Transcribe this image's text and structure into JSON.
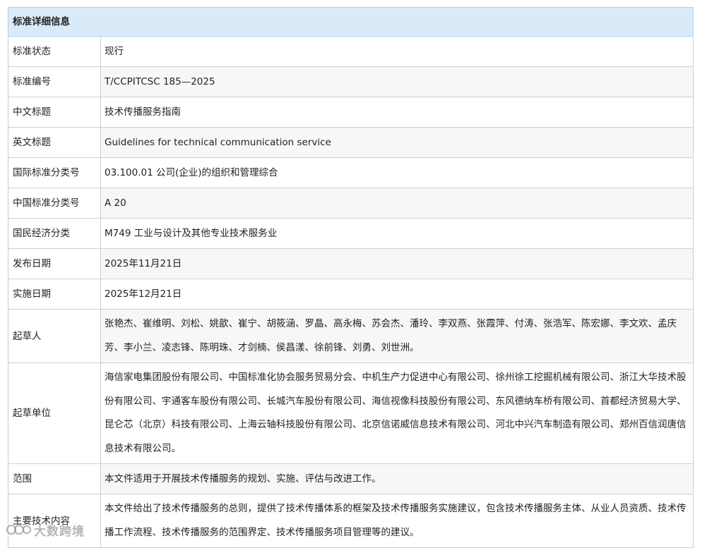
{
  "table": {
    "title": "标准详细信息",
    "rows": [
      {
        "label": "标准状态",
        "value": "现行"
      },
      {
        "label": "标准编号",
        "value": "T/CCPITCSC 185—2025"
      },
      {
        "label": "中文标题",
        "value": "技术传播服务指南"
      },
      {
        "label": "英文标题",
        "value": "Guidelines for technical communication service"
      },
      {
        "label": "国际标准分类号",
        "value": "03.100.01 公司(企业)的组织和管理综合"
      },
      {
        "label": "中国标准分类号",
        "value": "A 20"
      },
      {
        "label": "国民经济分类",
        "value": "M749 工业与设计及其他专业技术服务业"
      },
      {
        "label": "发布日期",
        "value": "2025年11月21日"
      },
      {
        "label": "实施日期",
        "value": "2025年12月21日"
      },
      {
        "label": "起草人",
        "value": "张艳杰、崔维明、刘松、姚歆、崔宁、胡筱涵、罗晶、高永梅、苏会杰、潘玲、李双燕、张霞萍、付涛、张浩军、陈宏娜、李文欢、孟庆芳、李小兰、凌志锋、陈明珠、才剑楠、侯昌漾、徐前锋、刘勇、刘世洲。"
      },
      {
        "label": "起草单位",
        "value": "海信家电集团股份有限公司、中国标准化协会服务贸易分会、中机生产力促进中心有限公司、徐州徐工挖掘机械有限公司、浙江大华技术股份有限公司、宇通客车股份有限公司、长城汽车股份有限公司、海信视像科技股份有限公司、东风德纳车桥有限公司、首都经济贸易大学、昆仑芯（北京）科技有限公司、上海云轴科技股份有限公司、北京信诺威信息技术有限公司、河北中兴汽车制造有限公司、郑州百信润唐信息技术有限公司。"
      },
      {
        "label": "范围",
        "value": "本文件适用于开展技术传播服务的规划、实施、评估与改进工作。"
      },
      {
        "label": "主要技术内容",
        "value": "本文件给出了技术传播服务的总则，提供了技术传播体系的框架及技术传播服务实施建议，包含技术传播服务主体、从业人员资质、技术传播工作流程、技术传播服务的范围界定、技术传播服务项目管理等的建议。"
      }
    ]
  },
  "watermark": {
    "text": "大数跨境"
  }
}
